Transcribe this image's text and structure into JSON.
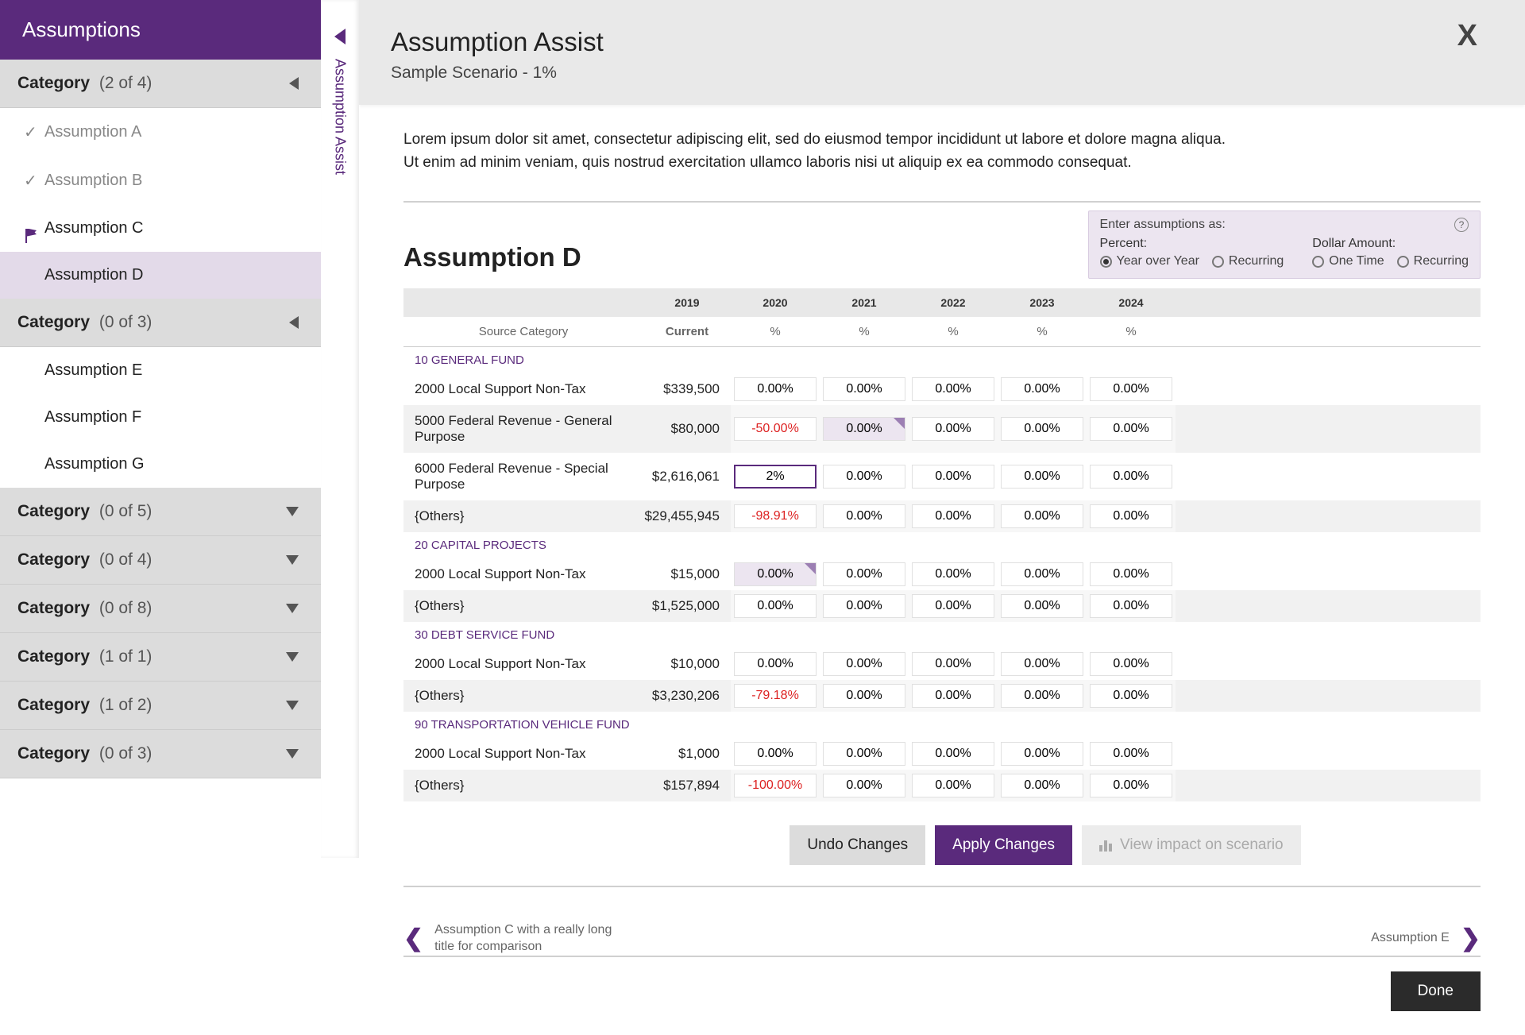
{
  "sidebar": {
    "title": "Assumptions",
    "category_label": "Category",
    "categories": [
      {
        "count": "(2 of 4)",
        "expanded": true,
        "arrow": "left",
        "items": [
          {
            "label": "Assumption A",
            "state": "completed"
          },
          {
            "label": "Assumption B",
            "state": "completed"
          },
          {
            "label": "Assumption C",
            "state": "flagged"
          },
          {
            "label": "Assumption D",
            "state": "active"
          }
        ]
      },
      {
        "count": "(0 of 3)",
        "expanded": true,
        "arrow": "left",
        "items": [
          {
            "label": "Assumption E",
            "state": "none"
          },
          {
            "label": "Assumption F",
            "state": "none"
          },
          {
            "label": "Assumption G",
            "state": "none"
          }
        ]
      },
      {
        "count": "(0 of 5)",
        "expanded": false,
        "arrow": "down"
      },
      {
        "count": "(0 of 4)",
        "expanded": false,
        "arrow": "down"
      },
      {
        "count": "(0 of 8)",
        "expanded": false,
        "arrow": "down"
      },
      {
        "count": "(1 of 1)",
        "expanded": false,
        "arrow": "down"
      },
      {
        "count": "(1 of 2)",
        "expanded": false,
        "arrow": "down"
      },
      {
        "count": "(0 of 3)",
        "expanded": false,
        "arrow": "down"
      }
    ]
  },
  "vtab": {
    "label": "Assumption Assist"
  },
  "header": {
    "title": "Assumption Assist",
    "subtitle": "Sample Scenario - 1%",
    "close": "X"
  },
  "description": {
    "line1": "Lorem ipsum dolor sit amet, consectetur adipiscing elit, sed do eiusmod tempor incididunt ut labore et dolore magna aliqua.",
    "line2": "Ut enim ad minim veniam, quis nostrud exercitation ullamco laboris nisi ut aliquip ex ea commodo consequat."
  },
  "options": {
    "prompt": "Enter assumptions as:",
    "pct_label": "Percent:",
    "amt_label": "Dollar Amount:",
    "pct": [
      {
        "label": "Year over Year",
        "selected": true
      },
      {
        "label": "Recurring",
        "selected": false
      }
    ],
    "amt": [
      {
        "label": "One Time",
        "selected": false
      },
      {
        "label": "Recurring",
        "selected": false
      }
    ]
  },
  "section_title": "Assumption D",
  "table": {
    "years": [
      "2019",
      "2020",
      "2021",
      "2022",
      "2023",
      "2024"
    ],
    "col_source": "Source Category",
    "col_current": "Current",
    "pct": "%",
    "groups": [
      {
        "label": "10 GENERAL FUND",
        "rows": [
          {
            "src": "2000 Local Support Non-Tax",
            "current": "$339,500",
            "cells": [
              "0.00%",
              "0.00%",
              "0.00%",
              "0.00%",
              "0.00%"
            ],
            "odd": false
          },
          {
            "src": "5000 Federal Revenue - General Purpose",
            "current": "$80,000",
            "cells": [
              "-50.00%",
              "0.00%",
              "0.00%",
              "0.00%",
              "0.00%"
            ],
            "odd": true,
            "tri": [
              1
            ],
            "shade": [
              1
            ]
          },
          {
            "src": "6000 Federal Revenue - Special Purpose",
            "current": "$2,616,061",
            "cells": [
              "2%",
              "0.00%",
              "0.00%",
              "0.00%",
              "0.00%"
            ],
            "odd": false,
            "edit": 0
          },
          {
            "src": "{Others}",
            "current": "$29,455,945",
            "cells": [
              "-98.91%",
              "0.00%",
              "0.00%",
              "0.00%",
              "0.00%"
            ],
            "odd": true
          }
        ]
      },
      {
        "label": "20 CAPITAL PROJECTS",
        "rows": [
          {
            "src": "2000 Local Support Non-Tax",
            "current": "$15,000",
            "cells": [
              "0.00%",
              "0.00%",
              "0.00%",
              "0.00%",
              "0.00%"
            ],
            "odd": false,
            "tri": [
              0
            ],
            "shade": [
              0
            ]
          },
          {
            "src": "{Others}",
            "current": "$1,525,000",
            "cells": [
              "0.00%",
              "0.00%",
              "0.00%",
              "0.00%",
              "0.00%"
            ],
            "odd": true
          }
        ]
      },
      {
        "label": "30 DEBT SERVICE FUND",
        "rows": [
          {
            "src": "2000 Local Support Non-Tax",
            "current": "$10,000",
            "cells": [
              "0.00%",
              "0.00%",
              "0.00%",
              "0.00%",
              "0.00%"
            ],
            "odd": false
          },
          {
            "src": "{Others}",
            "current": "$3,230,206",
            "cells": [
              "-79.18%",
              "0.00%",
              "0.00%",
              "0.00%",
              "0.00%"
            ],
            "odd": true
          }
        ]
      },
      {
        "label": "90 TRANSPORTATION VEHICLE FUND",
        "rows": [
          {
            "src": "2000 Local Support Non-Tax",
            "current": "$1,000",
            "cells": [
              "0.00%",
              "0.00%",
              "0.00%",
              "0.00%",
              "0.00%"
            ],
            "odd": false
          },
          {
            "src": "{Others}",
            "current": "$157,894",
            "cells": [
              "-100.00%",
              "0.00%",
              "0.00%",
              "0.00%",
              "0.00%"
            ],
            "odd": true
          }
        ]
      }
    ]
  },
  "buttons": {
    "undo": "Undo Changes",
    "apply": "Apply Changes",
    "view": "View impact on scenario"
  },
  "pager": {
    "prev": "Assumption C with a really long title for comparison",
    "next": "Assumption E"
  },
  "done": "Done"
}
